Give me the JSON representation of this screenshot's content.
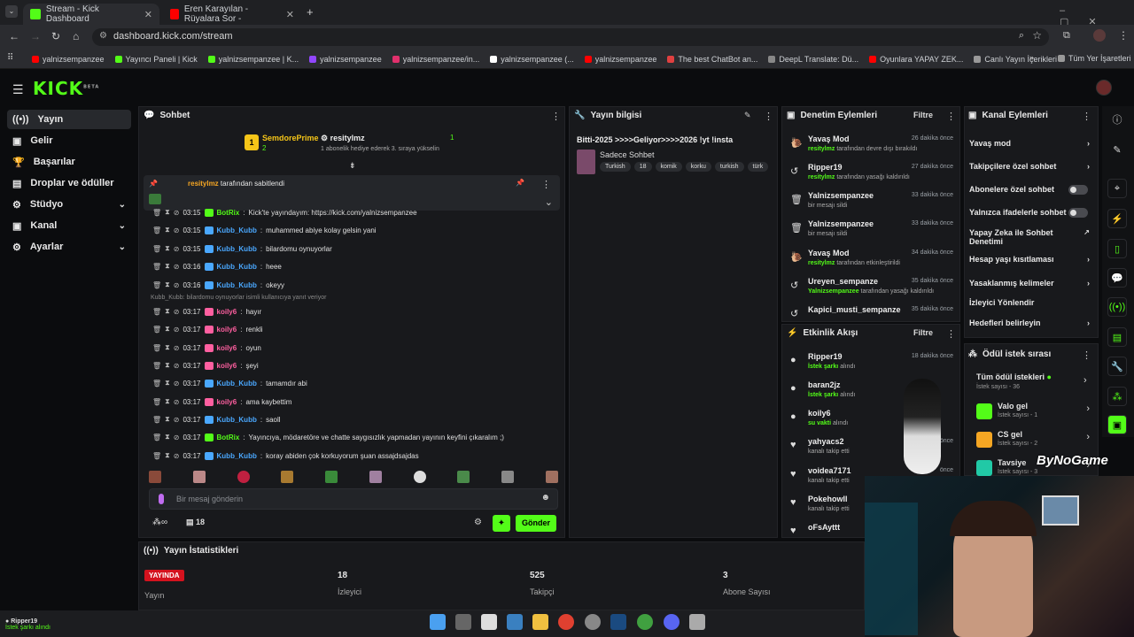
{
  "browser": {
    "tabs": [
      {
        "label": "Stream - Kick Dashboard",
        "active": true
      },
      {
        "label": "Eren Karayılan - Rüyalara Sor -",
        "active": false
      }
    ],
    "url": "dashboard.kick.com/stream",
    "bookmarks": [
      "yalnizsempanzee",
      "Yayıncı Paneli | Kick",
      "yalnizsempanzee | K...",
      "yalnizsempanzee",
      "yalnizsempanzee/in...",
      "yalnizsempanzee (...",
      "yalnizsempanzee",
      "The best ChatBot an...",
      "DeepL Translate: Dü...",
      "Oyunlara YAPAY ZEK...",
      "Canlı Yayın İçerikleri"
    ],
    "bookmarks_all": "Tüm Yer İşaretleri"
  },
  "app": {
    "logo": "KICK",
    "logo_sup": "BETA"
  },
  "sidebar": {
    "items": [
      {
        "label": "Yayın",
        "active": true
      },
      {
        "label": "Gelir"
      },
      {
        "label": "Başarılar"
      },
      {
        "label": "Droplar ve ödüller"
      },
      {
        "label": "Stüdyo",
        "expand": true
      },
      {
        "label": "Kanal",
        "expand": true
      },
      {
        "label": "Ayarlar",
        "expand": true
      }
    ]
  },
  "chat": {
    "title": "Sohbet",
    "gifter": {
      "name": "SemdorePrime",
      "count": "2",
      "rank": "1"
    },
    "gift_user": "resitylmz",
    "gift_count": "1",
    "gift_text": "1 abonelik hediye ederek 3. sıraya yükselin",
    "pinned_by": "resitylmz",
    "pinned_text": "tarafından sabitlendi",
    "reply_hint": "Kubb_Kubb: bilardomu oynuyorlar isimli kullanıcıya yanıt veriyor",
    "messages": [
      {
        "time": "03:15",
        "user": "BotRix",
        "color": "#53fc18",
        "text": "Kick'te yayındayım: https://kick.com/yalnizsempanzee"
      },
      {
        "time": "03:15",
        "user": "Kubb_Kubb",
        "color": "#4aa8ff",
        "text": "muhammed abiye kolay gelsin yani"
      },
      {
        "time": "03:15",
        "user": "Kubb_Kubb",
        "color": "#4aa8ff",
        "text": "bilardomu oynuyorlar"
      },
      {
        "time": "03:16",
        "user": "Kubb_Kubb",
        "color": "#4aa8ff",
        "text": "heee"
      },
      {
        "time": "03:16",
        "user": "Kubb_Kubb",
        "color": "#4aa8ff",
        "text": "okeyy"
      },
      {
        "time": "03:17",
        "user": "koily6",
        "color": "#ff5fa0",
        "text": "hayır"
      },
      {
        "time": "03:17",
        "user": "koily6",
        "color": "#ff5fa0",
        "text": "renkli"
      },
      {
        "time": "03:17",
        "user": "koily6",
        "color": "#ff5fa0",
        "text": "oyun"
      },
      {
        "time": "03:17",
        "user": "koily6",
        "color": "#ff5fa0",
        "text": "şeyi"
      },
      {
        "time": "03:17",
        "user": "Kubb_Kubb",
        "color": "#4aa8ff",
        "text": "tamamdır abi"
      },
      {
        "time": "03:17",
        "user": "koily6",
        "color": "#ff5fa0",
        "text": "ama kaybettim"
      },
      {
        "time": "03:17",
        "user": "Kubb_Kubb",
        "color": "#4aa8ff",
        "text": "saoll"
      },
      {
        "time": "03:17",
        "user": "BotRix",
        "color": "#53fc18",
        "text": "Yayıncıya, mödaretöre ve chatte saygısızlık yapmadan yayının keyfini çıkaralım ;)"
      },
      {
        "time": "03:17",
        "user": "Kubb_Kubb",
        "color": "#4aa8ff",
        "text": "koray abiden çok korkuyorum şuan assajdsajdas"
      }
    ],
    "input_placeholder": "Bir mesaj gönderin",
    "viewer_count": "18",
    "send_label": "Gönder",
    "infinity": "∞"
  },
  "stream_info": {
    "title": "Yayın bilgisi",
    "stream_title": "Bitti-2025 >>>>Geliyor>>>>2026 !yt !insta",
    "category": "Sadece Sohbet",
    "tags": [
      "Turkish",
      "18",
      "komik",
      "korku",
      "turkish",
      "türk"
    ]
  },
  "mod_actions": {
    "title": "Denetim Eylemleri",
    "filter": "Filtre",
    "items": [
      {
        "name": "Yavaş Mod",
        "actor": "resitylmz",
        "desc": "tarafından devre dışı bırakıldı",
        "time": "26 dakika önce",
        "icon": "🐌"
      },
      {
        "name": "Ripper19",
        "actor": "resitylmz",
        "desc": "tarafından yasağı kaldırıldı",
        "time": "27 dakika önce",
        "icon": "↺"
      },
      {
        "name": "Yalnizsempanzee",
        "actor": "",
        "desc": "bir mesajı sildi",
        "time": "33 dakika önce",
        "icon": "🗑"
      },
      {
        "name": "Yalnizsempanzee",
        "actor": "",
        "desc": "bir mesajı sildi",
        "time": "33 dakika önce",
        "icon": "🗑"
      },
      {
        "name": "Yavaş Mod",
        "actor": "resitylmz",
        "desc": "tarafından etkinleştirildi",
        "time": "34 dakika önce",
        "icon": "🐌"
      },
      {
        "name": "Ureyen_sempanze",
        "actor": "Yalnizsempanzee",
        "desc": "tarafından yasağı kaldırıldı",
        "time": "35 dakika önce",
        "icon": "↺"
      },
      {
        "name": "Kapici_musti_sempanze",
        "actor": "",
        "desc": "",
        "time": "35 dakika önce",
        "icon": "↺"
      }
    ]
  },
  "activity": {
    "title": "Etkinlik Akışı",
    "filter": "Filtre",
    "items": [
      {
        "name": "Ripper19",
        "desc": "İstek şarkı",
        "suffix": "alındı",
        "time": "18 dakika önce",
        "icon": "●"
      },
      {
        "name": "baran2jz",
        "desc": "İstek şarkı",
        "suffix": "alındı",
        "time": "",
        "icon": "●"
      },
      {
        "name": "koily6",
        "desc": "su vakti",
        "suffix": "alındı",
        "time": "",
        "icon": "●"
      },
      {
        "name": "yahyacs2",
        "desc": "",
        "suffix": "kanalı takip etti",
        "time": "önce",
        "icon": "♥"
      },
      {
        "name": "voidea7171",
        "desc": "",
        "suffix": "kanalı takip etti",
        "time": "önce",
        "icon": "♥"
      },
      {
        "name": "Pokehowll",
        "desc": "",
        "suffix": "kanalı takip etti",
        "time": "",
        "icon": "♥"
      },
      {
        "name": "oFsAyttt",
        "desc": "",
        "suffix": "",
        "time": "",
        "icon": "♥"
      }
    ]
  },
  "channel_actions": {
    "title": "Kanal Eylemleri",
    "items": [
      {
        "label": "Yavaş mod",
        "kind": "arrow"
      },
      {
        "label": "Takipçilere özel sohbet",
        "kind": "arrow"
      },
      {
        "label": "Abonelere özel sohbet",
        "kind": "toggle"
      },
      {
        "label": "Yalnızca ifadelerle sohbet",
        "kind": "toggle"
      },
      {
        "label": "Yapay Zeka ile Sohbet Denetimi",
        "kind": "ext"
      },
      {
        "label": "Hesap yaşı kısıtlaması",
        "kind": "arrow"
      },
      {
        "label": "Yasaklanmış kelimeler",
        "kind": "arrow"
      },
      {
        "label": "İzleyici Yönlendir",
        "kind": "none"
      },
      {
        "label": "Hedefleri belirleyin",
        "kind": "arrow"
      }
    ]
  },
  "rewards": {
    "title": "Ödül istek sırası",
    "all_label": "Tüm ödül istekleri",
    "all_count": "İstek sayısı - 36",
    "items": [
      {
        "label": "Valo gel",
        "count": "İstek sayısı - 1",
        "color": "#53fc18"
      },
      {
        "label": "CS gel",
        "count": "İstek sayısı - 2",
        "color": "#f5a623"
      },
      {
        "label": "Tavsiye",
        "count": "İstek sayısı - 3",
        "color": "#21c9a6"
      }
    ]
  },
  "stats": {
    "title": "Yayın İstatistikleri",
    "live_badge": "YAYINDA",
    "cols": [
      {
        "value": "",
        "label": "Yayın"
      },
      {
        "value": "18",
        "label": "İzleyici"
      },
      {
        "value": "525",
        "label": "Takipçi"
      },
      {
        "value": "3",
        "label": "Abone Sayısı"
      }
    ]
  },
  "overlay": {
    "watermark": "ByNoGame"
  },
  "notification": {
    "user": "Ripper19",
    "text": "İstek şarkı alındı"
  },
  "colors": {
    "accent": "#53fc18",
    "panel": "#18191c",
    "bg": "#0b0c0e"
  }
}
